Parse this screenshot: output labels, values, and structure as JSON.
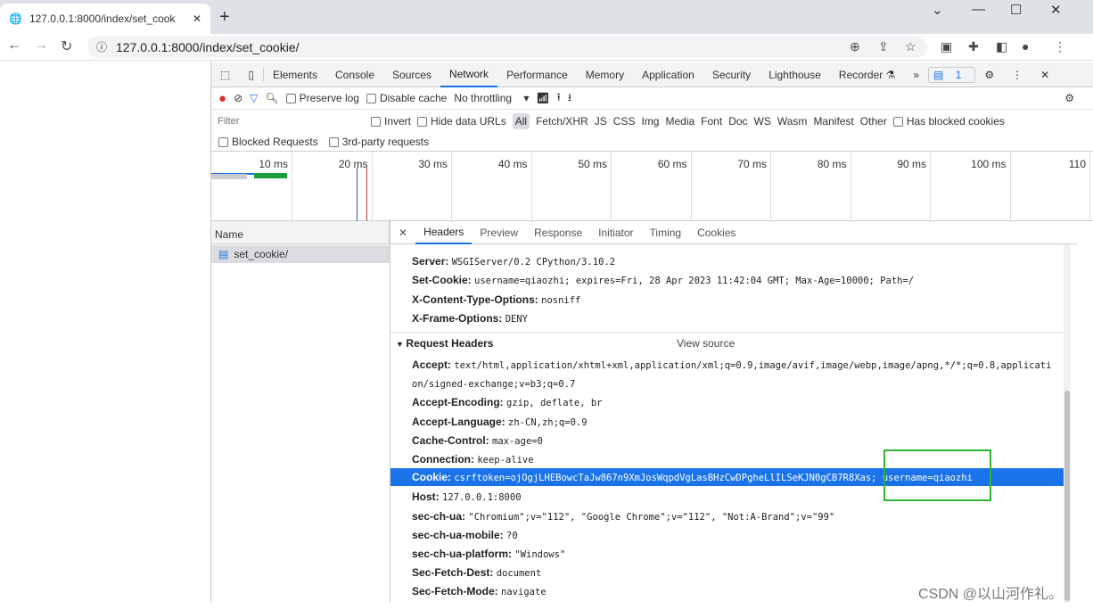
{
  "browser": {
    "tab_title": "127.0.0.1:8000/index/set_cook",
    "url": "127.0.0.1:8000/index/set_cookie/"
  },
  "devtools": {
    "tabs": [
      "Elements",
      "Console",
      "Sources",
      "Network",
      "Performance",
      "Memory",
      "Application",
      "Security",
      "Lighthouse",
      "Recorder ⚗",
      "»"
    ],
    "active_tab": "Network",
    "issues_count": "1",
    "toolbar": {
      "preserve_log": "Preserve log",
      "disable_cache": "Disable cache",
      "throttling": "No throttling"
    },
    "filter": {
      "placeholder": "Filter",
      "invert": "Invert",
      "hide_data_urls": "Hide data URLs",
      "types": [
        "All",
        "Fetch/XHR",
        "JS",
        "CSS",
        "Img",
        "Media",
        "Font",
        "Doc",
        "WS",
        "Wasm",
        "Manifest",
        "Other"
      ],
      "has_blocked_cookies": "Has blocked cookies",
      "blocked_requests": "Blocked Requests",
      "third_party": "3rd-party requests"
    },
    "timeline_ticks": [
      "10 ms",
      "20 ms",
      "30 ms",
      "40 ms",
      "50 ms",
      "60 ms",
      "70 ms",
      "80 ms",
      "90 ms",
      "100 ms",
      "110"
    ],
    "name_header": "Name",
    "requests": [
      "set_cookie/"
    ],
    "detail_tabs": [
      "Headers",
      "Preview",
      "Response",
      "Initiator",
      "Timing",
      "Cookies"
    ],
    "response_headers": [
      {
        "name": "Server:",
        "value": "WSGIServer/0.2 CPython/3.10.2"
      },
      {
        "name": "Set-Cookie:",
        "value": "username=qiaozhi; expires=Fri, 28 Apr 2023 11:42:04 GMT; Max-Age=10000; Path=/"
      },
      {
        "name": "X-Content-Type-Options:",
        "value": "nosniff"
      },
      {
        "name": "X-Frame-Options:",
        "value": "DENY"
      }
    ],
    "request_section": "Request Headers",
    "view_source": "View source",
    "request_headers": [
      {
        "name": "Accept:",
        "value": "text/html,application/xhtml+xml,application/xml;q=0.9,image/avif,image/webp,image/apng,*/*;q=0.8,applicati"
      },
      {
        "name": "",
        "value": "on/signed-exchange;v=b3;q=0.7"
      },
      {
        "name": "Accept-Encoding:",
        "value": "gzip, deflate, br"
      },
      {
        "name": "Accept-Language:",
        "value": "zh-CN,zh;q=0.9"
      },
      {
        "name": "Cache-Control:",
        "value": "max-age=0"
      },
      {
        "name": "Connection:",
        "value": "keep-alive"
      },
      {
        "name": "Cookie:",
        "value": "csrftoken=ojOgjLHEBowcTaJw867n9XmJosWqpdVgLasBHzCwDPgheLlILSeKJN0gCB7R8Xas; username=qiaozhi"
      },
      {
        "name": "Host:",
        "value": "127.0.0.1:8000"
      },
      {
        "name": "sec-ch-ua:",
        "value": "\"Chromium\";v=\"112\", \"Google Chrome\";v=\"112\", \"Not:A-Brand\";v=\"99\""
      },
      {
        "name": "sec-ch-ua-mobile:",
        "value": "?0"
      },
      {
        "name": "sec-ch-ua-platform:",
        "value": "\"Windows\""
      },
      {
        "name": "Sec-Fetch-Dest:",
        "value": "document"
      },
      {
        "name": "Sec-Fetch-Mode:",
        "value": "navigate"
      }
    ]
  },
  "watermark": "CSDN @以山河作礼。",
  "colors": {
    "accent": "#1a73e8",
    "highlight_box": "#2db52d",
    "record": "#d93025"
  }
}
